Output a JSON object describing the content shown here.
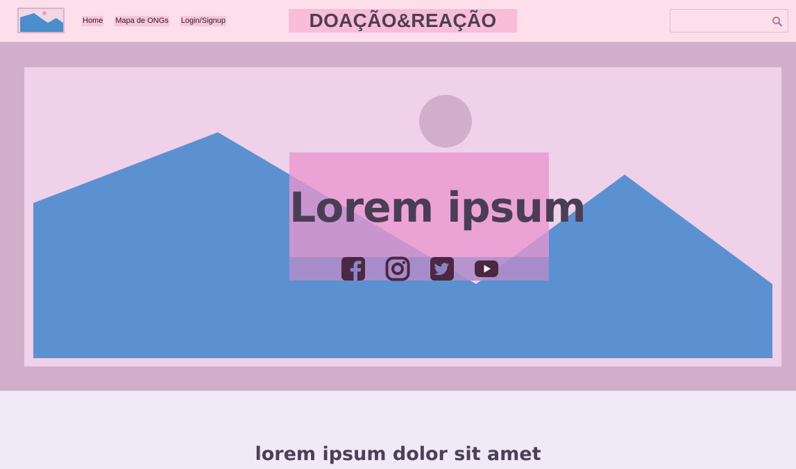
{
  "colors": {
    "nav_bg": "#fddeeb",
    "brand_bg": "#f9bdd9",
    "hero_frame": "#d1aeca",
    "hero_inner": "#f0d1ea",
    "mountains": "#5b91d0",
    "social_icon": "#4a2742",
    "page_bg": "#efe9f8"
  },
  "header": {
    "logo_icon": "image-placeholder-icon",
    "nav": [
      "Home",
      "Mapa de ONGs",
      "Login/Signup"
    ],
    "brand": "DOAÇÃO&REAÇÃO",
    "search": {
      "value": "",
      "placeholder": "",
      "icon": "search-icon"
    }
  },
  "hero": {
    "title": "Lorem ipsum",
    "socials": [
      "facebook-icon",
      "instagram-icon",
      "twitter-icon",
      "youtube-icon"
    ]
  },
  "section": {
    "heading": "lorem ipsum dolor sit amet"
  }
}
